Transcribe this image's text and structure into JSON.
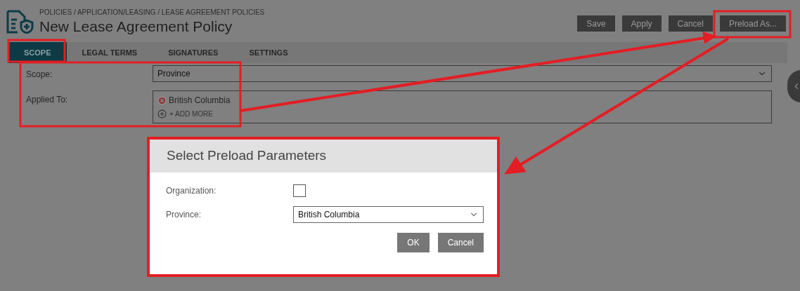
{
  "header": {
    "breadcrumb": "POLICIES / APPLICATION/LEASING / LEASE AGREEMENT POLICIES",
    "title": "New Lease Agreement Policy"
  },
  "actions": [
    {
      "label": "Save"
    },
    {
      "label": "Apply"
    },
    {
      "label": "Cancel"
    },
    {
      "label": "Preload As..."
    }
  ],
  "tabs": [
    {
      "label": "SCOPE",
      "selected": true
    },
    {
      "label": "LEGAL TERMS",
      "selected": false
    },
    {
      "label": "SIGNATURES",
      "selected": false
    },
    {
      "label": "SETTINGS",
      "selected": false
    }
  ],
  "form": {
    "scope": {
      "label": "Scope:",
      "value": "Province"
    },
    "applied_to": {
      "label": "Applied To:",
      "tags": [
        "British Columbia"
      ],
      "add_more": "+ ADD MORE"
    }
  },
  "dialog": {
    "title": "Select Preload Parameters",
    "fields": [
      {
        "kind": "checkbox",
        "label": "Organization:",
        "checked": false
      },
      {
        "kind": "select",
        "label": "Province:",
        "value": "British Columbia"
      }
    ],
    "buttons": [
      {
        "label": "OK"
      },
      {
        "label": "Cancel"
      }
    ]
  }
}
